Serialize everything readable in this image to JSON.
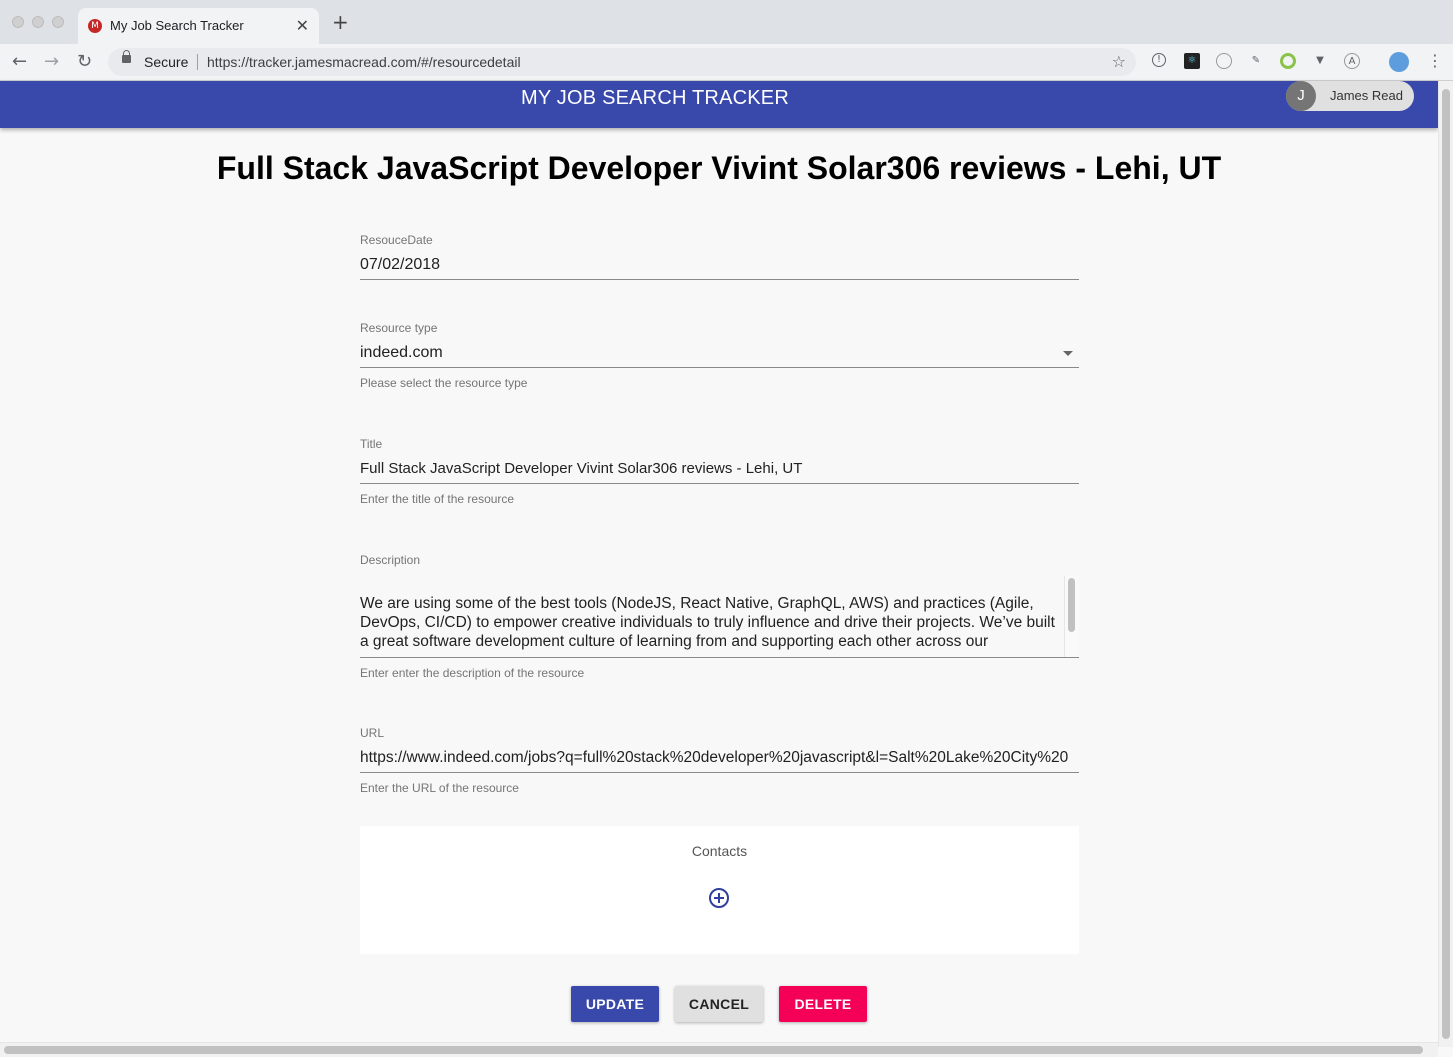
{
  "browser": {
    "tab_title": "My Job Search Tracker",
    "favicon_letter": "M",
    "secure_label": "Secure",
    "url": "https://tracker.jamesmacread.com/#/resourcedetail",
    "close_glyph": "✕",
    "newtab_glyph": "+",
    "back_glyph": "←",
    "forward_glyph": "→",
    "reload_glyph": "↻",
    "star_glyph": "☆",
    "menu_glyph": "⋮"
  },
  "app": {
    "title": "MY JOB SEARCH TRACKER",
    "user_initial": "J",
    "user_name": "James Read",
    "brand_color": "#3949ab"
  },
  "page": {
    "title": "Full Stack JavaScript Developer Vivint Solar306 reviews - Lehi, UT"
  },
  "form": {
    "date": {
      "label": "ResouceDate",
      "value": "07/02/2018"
    },
    "resource_type": {
      "label": "Resource type",
      "value": "indeed.com",
      "helper": "Please select the resource type"
    },
    "title": {
      "label": "Title",
      "value": "Full Stack JavaScript Developer Vivint Solar306 reviews - Lehi, UT",
      "helper": "Enter the title of the resource"
    },
    "description": {
      "label": "Description",
      "value": "We are using some of the best tools (NodeJS, React Native, GraphQL, AWS) and practices (Agile, DevOps, CI/CD) to empower creative individuals to truly influence and drive their projects. We’ve built a great software development culture of learning from and supporting each other across our",
      "helper": "Enter enter the description of the resource"
    },
    "url": {
      "label": "URL",
      "value": "https://www.indeed.com/jobs?q=full%20stack%20developer%20javascript&l=Salt%20Lake%20City%20",
      "helper": "Enter the URL of the resource"
    }
  },
  "contacts": {
    "title": "Contacts"
  },
  "actions": {
    "update": "UPDATE",
    "cancel": "CANCEL",
    "delete": "DELETE",
    "update_color": "#3949ab",
    "delete_color": "#f50057"
  }
}
